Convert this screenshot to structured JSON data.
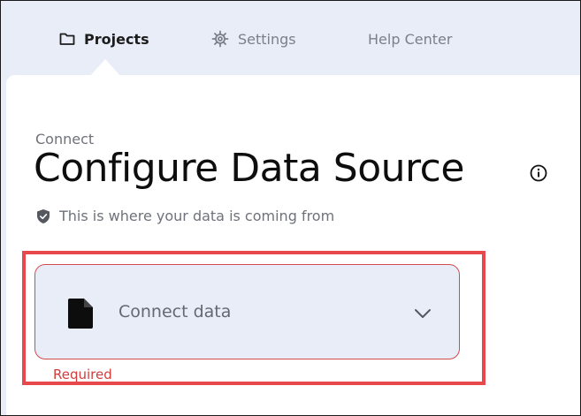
{
  "nav": {
    "items": [
      {
        "label": "Projects",
        "icon": "folder-icon",
        "active": true
      },
      {
        "label": "Settings",
        "icon": "gear-icon",
        "active": false
      },
      {
        "label": "Help Center",
        "icon": "",
        "active": false
      }
    ]
  },
  "header": {
    "eyebrow": "Connect",
    "title": "Configure Data Source",
    "info_icon": "info-icon",
    "subtitle": "This is where your data is coming from",
    "subtitle_icon": "shield-check-icon"
  },
  "field": {
    "label": "Connect data",
    "icon": "file-icon",
    "dropdown_icon": "chevron-down-icon",
    "error": "Required"
  },
  "colors": {
    "nav_background": "#e8edf8",
    "error": "#d43c3c",
    "highlight": "#e8484c",
    "field_background": "#e8edf8"
  }
}
